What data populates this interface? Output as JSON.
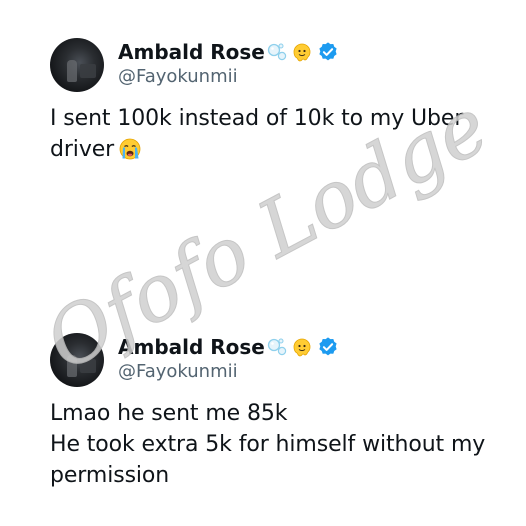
{
  "tweets": [
    {
      "name": "Ambald Rose",
      "handle": "@Fayokunmii",
      "lines": [
        "I sent 100k instead of 10k to my Uber",
        "driver"
      ],
      "emoji_after_name": [
        "bubbles-icon",
        "melting-face-icon"
      ],
      "badge": "verified-badge-icon",
      "trailing_emoji": "loudly-crying-face-icon"
    },
    {
      "name": "Ambald Rose",
      "handle": "@Fayokunmii",
      "lines": [
        "Lmao he sent me 85k",
        "He took extra 5k for himself without my",
        "permission"
      ],
      "emoji_after_name": [
        "bubbles-icon",
        "melting-face-icon"
      ],
      "badge": "verified-badge-icon"
    }
  ],
  "watermark": {
    "text": "Ofofo Lodge",
    "color": "#cfcfcf"
  },
  "colors": {
    "text": "#0f1419",
    "handle": "#536471",
    "verified": "#1d9bf0"
  }
}
